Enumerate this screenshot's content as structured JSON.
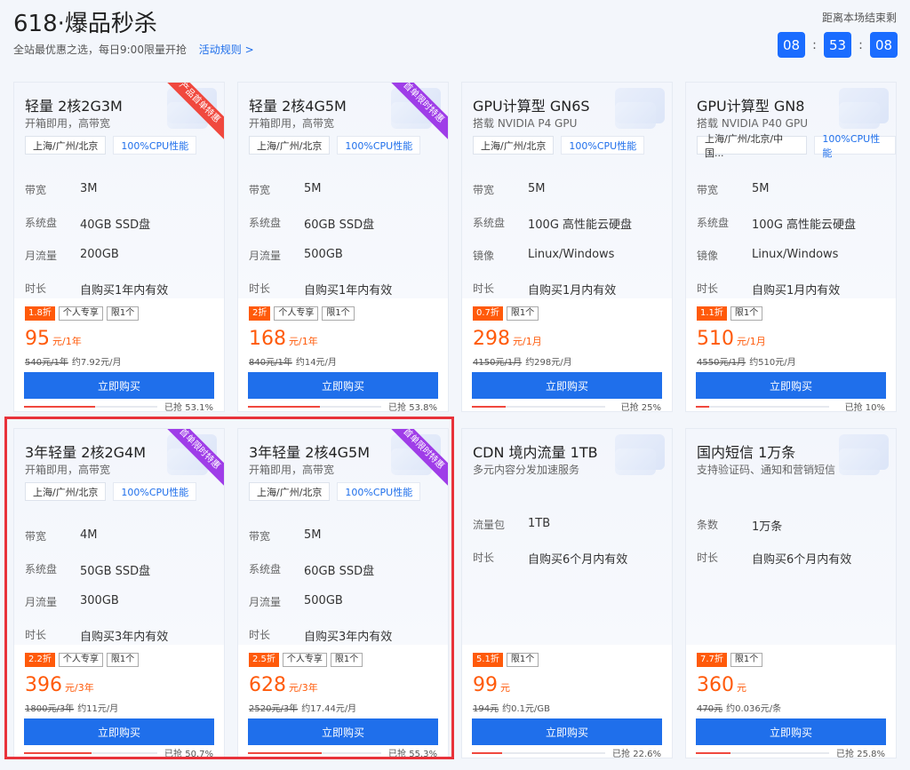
{
  "header": {
    "title": "618·爆品秒杀",
    "subtitle": "全站最优惠之选，每日9:00限量开抢",
    "rules_link": "活动规则 >",
    "countdown_label": "距离本场结束剩",
    "hours": "08",
    "minutes": "53",
    "seconds": "08"
  },
  "cards": [
    {
      "name": "轻量 2核2G3M",
      "subtitle": "开箱即用，高带宽",
      "ribbon": "产品首单特惠",
      "ribbon_color": "#f0483e",
      "region": "上海/广州/北京",
      "perf_tag": "100%CPU性能",
      "specs": [
        [
          "带宽",
          "3M"
        ],
        [
          "系统盘",
          "40GB SSD盘"
        ],
        [
          "月流量",
          "200GB"
        ],
        [
          "时长",
          "自购买1年内有效"
        ]
      ],
      "discount": "1.8折",
      "tags": [
        "个人专享",
        "限1个"
      ],
      "price": "95",
      "unit": "元/1年",
      "original": "540元/1年",
      "monthly": "约7.92元/月",
      "buy": "立即购买",
      "sold_text": "已抢 53.1%",
      "sold_pct": 53.1
    },
    {
      "name": "轻量 2核4G5M",
      "subtitle": "开箱即用，高带宽",
      "ribbon": "首单限时特惠",
      "ribbon_color": "#9f3de8",
      "region": "上海/广州/北京",
      "perf_tag": "100%CPU性能",
      "specs": [
        [
          "带宽",
          "5M"
        ],
        [
          "系统盘",
          "60GB SSD盘"
        ],
        [
          "月流量",
          "500GB"
        ],
        [
          "时长",
          "自购买1年内有效"
        ]
      ],
      "discount": "2折",
      "tags": [
        "个人专享",
        "限1个"
      ],
      "price": "168",
      "unit": "元/1年",
      "original": "840元/1年",
      "monthly": "约14元/月",
      "buy": "立即购买",
      "sold_text": "已抢 53.8%",
      "sold_pct": 53.8
    },
    {
      "name": "GPU计算型 GN6S",
      "subtitle": "搭载 NVIDIA P4 GPU",
      "ribbon": "",
      "ribbon_color": "",
      "region": "上海/广州/北京",
      "perf_tag": "100%CPU性能",
      "specs": [
        [
          "带宽",
          "5M"
        ],
        [
          "系统盘",
          "100G 高性能云硬盘"
        ],
        [
          "镜像",
          "Linux/Windows"
        ],
        [
          "时长",
          "自购买1月内有效"
        ]
      ],
      "discount": "0.7折",
      "tags": [
        "限1个"
      ],
      "price": "298",
      "unit": "元/1月",
      "original": "4150元/1月",
      "monthly": "约298元/月",
      "buy": "立即购买",
      "sold_text": "已抢 25%",
      "sold_pct": 25
    },
    {
      "name": "GPU计算型 GN8",
      "subtitle": "搭载 NVIDIA P40 GPU",
      "ribbon": "",
      "ribbon_color": "",
      "region": "上海/广州/北京/中国...",
      "perf_tag": "100%CPU性能",
      "specs": [
        [
          "带宽",
          "5M"
        ],
        [
          "系统盘",
          "100G 高性能云硬盘"
        ],
        [
          "镜像",
          "Linux/Windows"
        ],
        [
          "时长",
          "自购买1月内有效"
        ]
      ],
      "discount": "1.1折",
      "tags": [
        "限1个"
      ],
      "price": "510",
      "unit": "元/1月",
      "original": "4550元/1月",
      "monthly": "约510元/月",
      "buy": "立即购买",
      "sold_text": "已抢 10%",
      "sold_pct": 10
    },
    {
      "name": "3年轻量 2核2G4M",
      "subtitle": "开箱即用，高带宽",
      "ribbon": "首单限时特惠",
      "ribbon_color": "#9f3de8",
      "region": "上海/广州/北京",
      "perf_tag": "100%CPU性能",
      "specs": [
        [
          "带宽",
          "4M"
        ],
        [
          "系统盘",
          "50GB SSD盘"
        ],
        [
          "月流量",
          "300GB"
        ],
        [
          "时长",
          "自购买3年内有效"
        ]
      ],
      "discount": "2.2折",
      "tags": [
        "个人专享",
        "限1个"
      ],
      "price": "396",
      "unit": "元/3年",
      "original": "1800元/3年",
      "monthly": "约11元/月",
      "buy": "立即购买",
      "sold_text": "已抢 50.7%",
      "sold_pct": 50.7
    },
    {
      "name": "3年轻量 2核4G5M",
      "subtitle": "开箱即用，高带宽",
      "ribbon": "首单限时特惠",
      "ribbon_color": "#9f3de8",
      "region": "上海/广州/北京",
      "perf_tag": "100%CPU性能",
      "specs": [
        [
          "带宽",
          "5M"
        ],
        [
          "系统盘",
          "60GB SSD盘"
        ],
        [
          "月流量",
          "500GB"
        ],
        [
          "时长",
          "自购买3年内有效"
        ]
      ],
      "discount": "2.5折",
      "tags": [
        "个人专享",
        "限1个"
      ],
      "price": "628",
      "unit": "元/3年",
      "original": "2520元/3年",
      "monthly": "约17.44元/月",
      "buy": "立即购买",
      "sold_text": "已抢 55.3%",
      "sold_pct": 55.3
    },
    {
      "name": "CDN 境内流量 1TB",
      "subtitle": "多元内容分发加速服务",
      "ribbon": "",
      "ribbon_color": "",
      "region": "",
      "perf_tag": "",
      "specs": [
        [
          "流量包",
          "1TB"
        ],
        [
          "时长",
          "自购买6个月内有效"
        ]
      ],
      "discount": "5.1折",
      "tags": [
        "限1个"
      ],
      "price": "99",
      "unit": "元",
      "original": "194元",
      "monthly": "约0.1元/GB",
      "buy": "立即购买",
      "sold_text": "已抢 22.6%",
      "sold_pct": 22.6
    },
    {
      "name": "国内短信 1万条",
      "subtitle": "支持验证码、通知和营销短信",
      "ribbon": "",
      "ribbon_color": "",
      "region": "",
      "perf_tag": "",
      "specs": [
        [
          "条数",
          "1万条"
        ],
        [
          "时长",
          "自购买6个月内有效"
        ]
      ],
      "discount": "7.7折",
      "tags": [
        "限1个"
      ],
      "price": "360",
      "unit": "元",
      "original": "470元",
      "monthly": "约0.036元/条",
      "buy": "立即购买",
      "sold_text": "已抢 25.8%",
      "sold_pct": 25.8
    }
  ]
}
